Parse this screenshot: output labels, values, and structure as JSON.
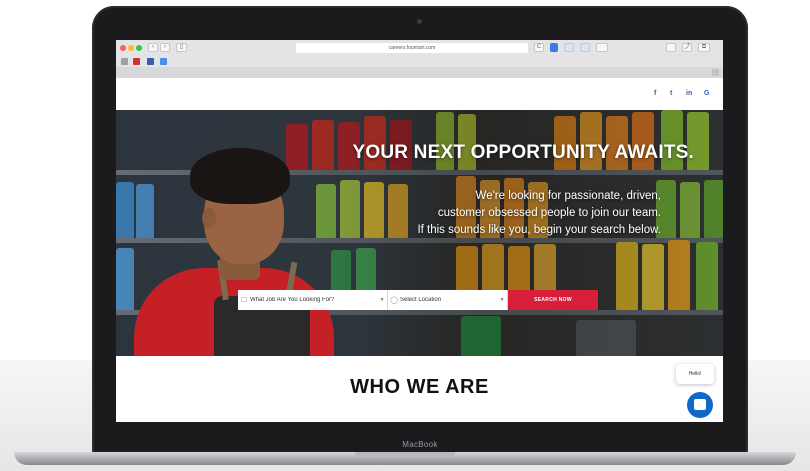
{
  "browser": {
    "url": "careers.fountain.com",
    "nav_back": "‹",
    "nav_forward": "›",
    "sidebar": "▯",
    "reload": "C",
    "share": "⤴",
    "tabs": "⧉"
  },
  "social": {
    "facebook": "f",
    "twitter": "t",
    "linkedin": "in",
    "other": "G"
  },
  "hero": {
    "title": "YOUR NEXT OPPORTUNITY AWAITS.",
    "subtitle_lines": [
      "We're looking for passionate, driven,",
      "customer obsessed people to join our team.",
      "If this sounds like you, begin your search below."
    ]
  },
  "search": {
    "job_placeholder": "What Job Are You Looking For?",
    "location_placeholder": "Select Location",
    "button_label": "SEARCH NOW"
  },
  "who": {
    "title": "WHO WE ARE"
  },
  "chat": {
    "greeting": "Hello!"
  },
  "device": {
    "brand": "MacBook"
  },
  "colors": {
    "accent_red": "#d71f3a",
    "chat_blue": "#1268c6"
  }
}
